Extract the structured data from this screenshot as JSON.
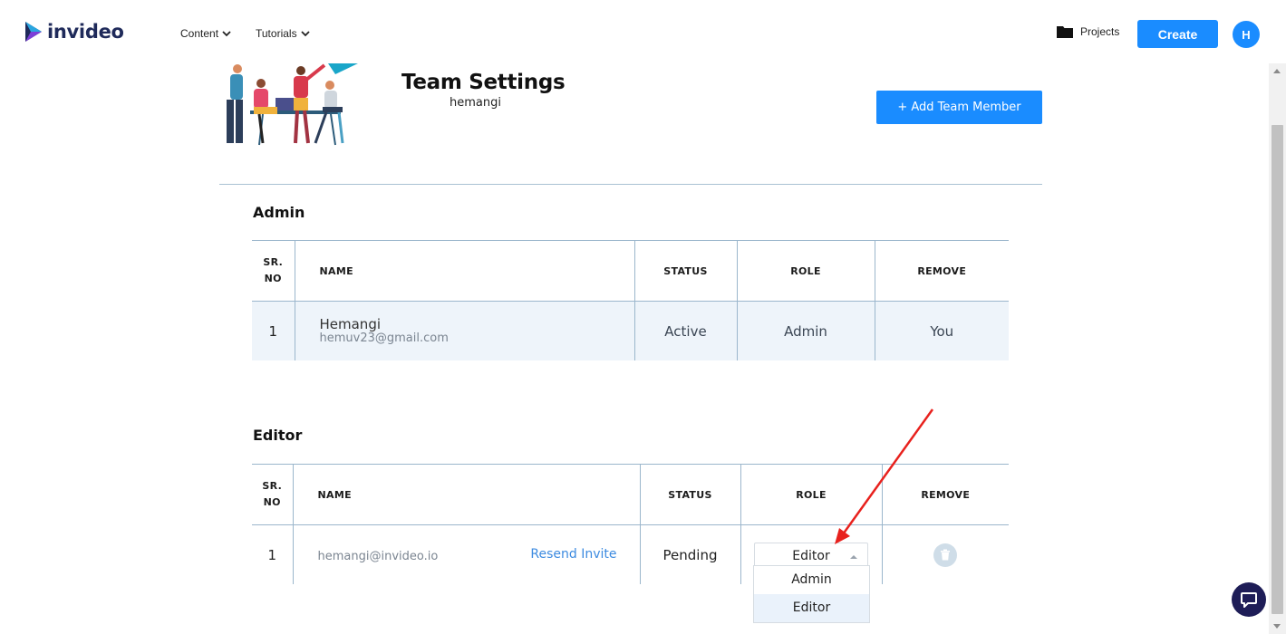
{
  "nav": {
    "logo_text": "invideo",
    "menus": [
      {
        "label": "Content"
      },
      {
        "label": "Tutorials"
      }
    ],
    "projects_label": "Projects",
    "create_label": "Create",
    "avatar_initial": "H"
  },
  "header": {
    "title": "Team Settings",
    "team_name": "hemangi",
    "add_member_label": "+ Add Team Member"
  },
  "admin": {
    "section_title": "Admin",
    "columns": {
      "sr": "SR. NO",
      "name": "NAME",
      "status": "STATUS",
      "role": "ROLE",
      "remove": "REMOVE"
    },
    "rows": [
      {
        "sr": "1",
        "name": "Hemangi",
        "email": "hemuv23@gmail.com",
        "status": "Active",
        "role": "Admin",
        "remove": "You"
      }
    ]
  },
  "editor": {
    "section_title": "Editor",
    "columns": {
      "sr": "SR. NO",
      "name": "NAME",
      "status": "STATUS",
      "role": "ROLE",
      "remove": "REMOVE"
    },
    "rows": [
      {
        "sr": "1",
        "email": "hemangi@invideo.io",
        "resend_label": "Resend Invite",
        "status": "Pending",
        "role": "Editor"
      }
    ],
    "role_options": [
      "Admin",
      "Editor"
    ],
    "selected_role": "Editor"
  },
  "icons": {
    "chevron": "chevron-down-icon",
    "folder": "folder-icon",
    "trash": "trash-icon",
    "chat": "chat-icon"
  },
  "colors": {
    "accent": "#1a8cff",
    "annotation_arrow": "#e8211d",
    "chat_bubble": "#1e1d57"
  }
}
